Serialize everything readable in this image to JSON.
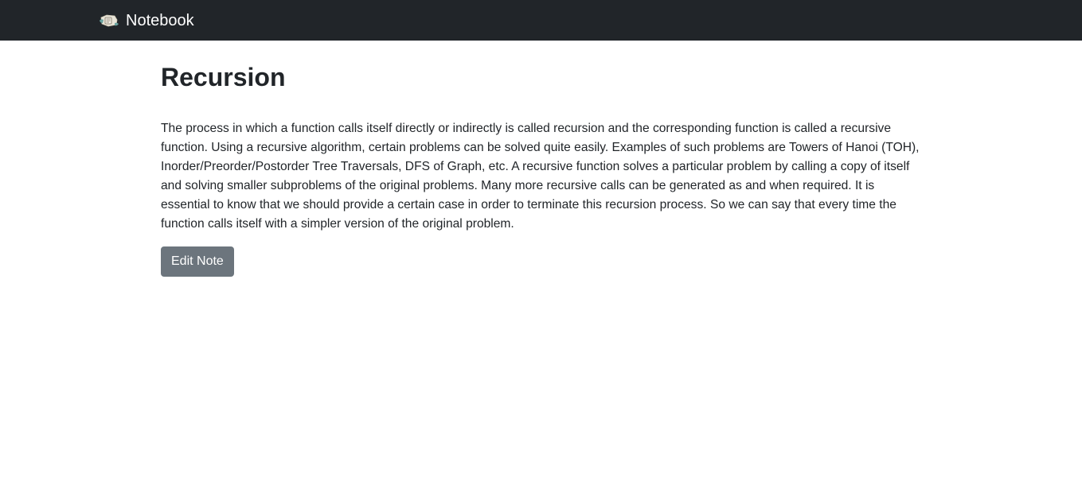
{
  "navbar": {
    "brand_icon": "notebook-icon",
    "brand_label": "Notebook"
  },
  "note": {
    "title": "Recursion",
    "body": "The process in which a function calls itself directly or indirectly is called recursion and the corresponding function is called a recursive function. Using a recursive algorithm, certain problems can be solved quite easily. Examples of such problems are Towers of Hanoi (TOH), Inorder/Preorder/Postorder Tree Traversals, DFS of Graph, etc. A recursive function solves a particular problem by calling a copy of itself and solving smaller subproblems of the original problems. Many more recursive calls can be generated as and when required. It is essential to know that we should provide a certain case in order to terminate this recursion process. So we can say that every time the function calls itself with a simpler version of the original problem.",
    "edit_label": "Edit Note"
  },
  "colors": {
    "navbar_bg": "#212529",
    "button_bg": "#6c757d",
    "text": "#212529"
  }
}
